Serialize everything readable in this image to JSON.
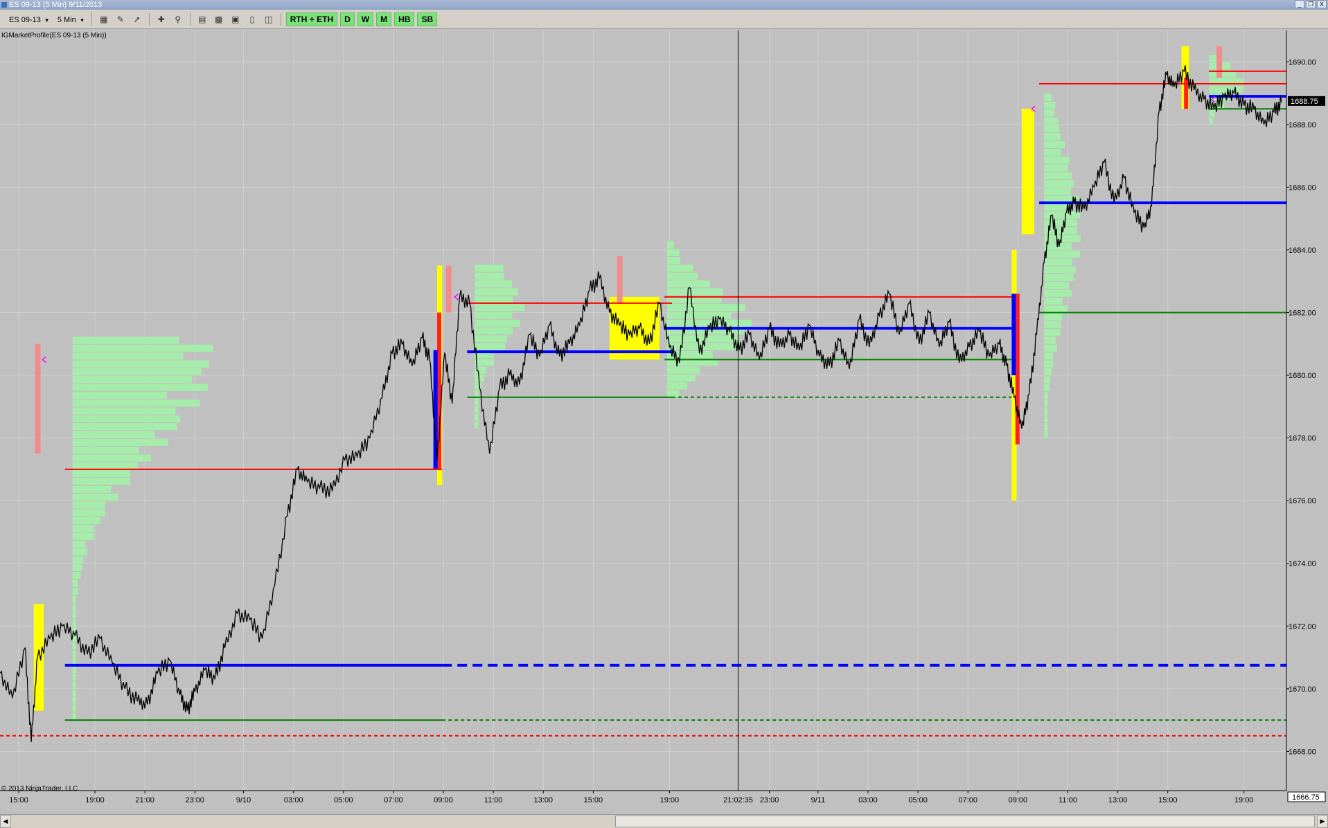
{
  "window": {
    "title": "ES 09-13 (5 Min)  9/11/2013",
    "buttons": [
      "_",
      "❐",
      "X"
    ]
  },
  "toolbar": {
    "instrument": "ES 09-13",
    "interval": "5 Min",
    "range_buttons": [
      "RTH + ETH",
      "D",
      "W",
      "M",
      "HB",
      "SB"
    ],
    "icons": [
      "bar-style-icon",
      "pencil-icon",
      "drawing-tool-icon",
      "crosshair-icon",
      "zoom-icon",
      "properties-icon",
      "strategy-icon",
      "data-box-icon",
      "indicator-icon",
      "chart-trader-icon"
    ]
  },
  "indicator_label": "IGMarketProfile(ES 09-13 (5 Min))",
  "copyright": "© 2013 NinjaTrader, LLC",
  "colors": {
    "background": "#c0c0c0",
    "grid": "#d0d0d0",
    "price": "#000000",
    "poc": "#0000ff",
    "vah": "#ff0000",
    "val": "#008000",
    "profile_green": "#a6ecaa",
    "value_area_yellow": "#ffff00",
    "tpo_pink": "#f08c8c",
    "marker_magenta": "#ff00ff"
  },
  "chart_data": {
    "type": "line",
    "title": "",
    "instrument": "ES 09-13",
    "interval": "5 Min",
    "ylim": [
      1666.75,
      1691
    ],
    "y_ticks": [
      1668,
      1670,
      1672,
      1674,
      1676,
      1678,
      1680,
      1682,
      1684,
      1686,
      1688,
      1690
    ],
    "y_tick_labels": [
      "1668.00",
      "1670.00",
      "1672.00",
      "1674.00",
      "1676.00",
      "1678.00",
      "1680.00",
      "1682.00",
      "1684.00",
      "1686.00",
      "1688.00",
      "1690.00"
    ],
    "x_tick_labels": [
      "15:00",
      "19:00",
      "21:00",
      "23:00",
      "9/10",
      "03:00",
      "05:00",
      "07:00",
      "09:00",
      "11:00",
      "13:00",
      "15:00",
      "19:00",
      "23:00",
      "9/11",
      "03:00",
      "05:00",
      "07:00",
      "09:00",
      "11:00",
      "13:00",
      "15:00",
      "19:00"
    ],
    "x_tick_positions": [
      0.75,
      3.8,
      5.8,
      7.8,
      9.75,
      11.75,
      13.75,
      15.75,
      17.75,
      19.75,
      21.75,
      23.75,
      26.8,
      30.8,
      32.75,
      34.75,
      36.75,
      38.75,
      40.75,
      42.75,
      44.75,
      46.75,
      49.8
    ],
    "x_range": [
      0,
      51.5
    ],
    "last_price": "1688.75",
    "axis_bottom_label": "1666.75",
    "crosshair": {
      "x": 29.55,
      "label": "21:02:35"
    },
    "price_series": {
      "name": "ES 09-13",
      "x": [
        0,
        0.5,
        1,
        1.25,
        1.5,
        2.0,
        2.5,
        3.0,
        3.5,
        4.0,
        4.5,
        5.0,
        5.5,
        5.9,
        6.3,
        6.8,
        7.2,
        7.5,
        7.8,
        8.2,
        8.6,
        9.0,
        9.5,
        10.0,
        10.5,
        11.0,
        11.5,
        11.9,
        12.3,
        12.8,
        13.3,
        13.8,
        14.3,
        14.8,
        15.3,
        15.7,
        16.1,
        16.5,
        16.9,
        17.2,
        17.5,
        17.8,
        18.1,
        18.4,
        18.8,
        19.2,
        19.6,
        20.0,
        20.4,
        20.8,
        21.2,
        21.6,
        22.0,
        22.4,
        22.8,
        23.2,
        23.6,
        24.0,
        24.4,
        24.8,
        25.2,
        25.6,
        26.0,
        26.4,
        26.8,
        27.2,
        27.6,
        28.0,
        28.4,
        28.8,
        29.2,
        29.6,
        30.0,
        30.4,
        30.8,
        31.2,
        31.6,
        32.0,
        32.4,
        32.8,
        33.2,
        33.6,
        34.0,
        34.4,
        34.8,
        35.2,
        35.6,
        36.0,
        36.4,
        36.8,
        37.2,
        37.6,
        38.0,
        38.4,
        38.8,
        39.2,
        39.6,
        40.0,
        40.3,
        40.6,
        40.9,
        41.2,
        41.5,
        41.8,
        42.1,
        42.4,
        42.7,
        43.0,
        43.4,
        43.8,
        44.2,
        44.6,
        45.0,
        45.4,
        45.8,
        46.1,
        46.4,
        46.7,
        47.0,
        47.4,
        47.8,
        48.2,
        48.6,
        49.0,
        49.4,
        49.8,
        50.2,
        50.6,
        51.0,
        51.3
      ],
      "y": [
        1670.5,
        1669.7,
        1671.3,
        1668.3,
        1671.0,
        1671.6,
        1672.0,
        1671.7,
        1671.1,
        1671.6,
        1670.8,
        1670.0,
        1669.6,
        1669.5,
        1670.5,
        1670.9,
        1669.8,
        1669.3,
        1669.9,
        1670.6,
        1670.3,
        1671.3,
        1672.4,
        1672.2,
        1671.6,
        1673.3,
        1675.5,
        1677.0,
        1676.6,
        1676.4,
        1676.3,
        1677.3,
        1677.4,
        1678.0,
        1679.3,
        1680.7,
        1681.0,
        1680.3,
        1681.2,
        1680.5,
        1677.3,
        1680.7,
        1679.1,
        1682.5,
        1682.3,
        1679.6,
        1677.5,
        1679.6,
        1680.0,
        1679.7,
        1681.3,
        1680.6,
        1681.6,
        1680.6,
        1681.0,
        1681.6,
        1682.7,
        1683.1,
        1682.0,
        1681.6,
        1681.3,
        1681.5,
        1681.0,
        1682.3,
        1680.9,
        1680.4,
        1682.8,
        1680.7,
        1681.5,
        1681.8,
        1681.4,
        1680.8,
        1681.3,
        1680.5,
        1681.5,
        1680.9,
        1681.3,
        1680.8,
        1681.6,
        1680.6,
        1680.3,
        1681.1,
        1680.2,
        1681.8,
        1680.9,
        1681.9,
        1682.6,
        1681.3,
        1682.3,
        1681.0,
        1682.0,
        1680.9,
        1681.7,
        1680.4,
        1680.9,
        1681.4,
        1680.6,
        1681.0,
        1680.3,
        1679.3,
        1678.3,
        1679.4,
        1681.3,
        1683.6,
        1685.1,
        1684.1,
        1685.2,
        1685.5,
        1685.3,
        1686.0,
        1686.8,
        1685.5,
        1686.3,
        1685.2,
        1684.7,
        1685.4,
        1688.4,
        1689.6,
        1689.2,
        1689.7,
        1689.1,
        1688.8,
        1688.5,
        1688.9,
        1689.0,
        1688.6,
        1688.5,
        1688.0,
        1688.4,
        1688.7
      ]
    },
    "profile_lines": [
      {
        "session": 1,
        "vah": 1677.0,
        "poc": 1670.75,
        "val": 1669.0,
        "x_start": 2.6,
        "x_end": 17.7
      },
      {
        "session": 2,
        "vah": 1682.3,
        "poc": 1680.75,
        "val": 1679.3,
        "x_start": 18.7,
        "x_end": 26.9
      },
      {
        "session": 3,
        "vah": 1682.5,
        "poc": 1681.5,
        "val": 1680.5,
        "x_start": 26.6,
        "x_end": 40.5
      },
      {
        "session": 4,
        "vah": 1689.3,
        "poc": 1685.5,
        "val": 1682.0,
        "x_start": 41.6,
        "x_end": 51.5
      },
      {
        "session": 5,
        "vah": 1689.7,
        "poc": 1688.9,
        "val": 1688.5,
        "x_start": 48.4,
        "x_end": 51.5
      }
    ],
    "extended_lines": [
      {
        "kind": "poc",
        "y": 1670.75,
        "x_start": 17.7,
        "x_end": 51.5
      },
      {
        "kind": "poc",
        "y": 1680.75,
        "x_start": 26.9,
        "x_end": 27.0
      },
      {
        "kind": "poc",
        "y": 1685.5,
        "x_start": 47.0,
        "x_end": 51.5
      },
      {
        "kind": "val",
        "y": 1669.0,
        "x_start": 17.7,
        "x_end": 51.5
      },
      {
        "kind": "val",
        "y": 1679.3,
        "x_start": 26.9,
        "x_end": 40.5
      },
      {
        "kind": "val",
        "y": 1682.0,
        "x_start": 47.0,
        "x_end": 51.5
      },
      {
        "kind": "vah",
        "y": 1668.5,
        "x_start": 0,
        "x_end": 51.5
      }
    ],
    "volume_profiles": [
      {
        "x_start": 2.9,
        "y_low": 1669.0,
        "y_high": 1681.0,
        "peak_y": 1680.3,
        "peak_width": 5.7
      },
      {
        "x_start": 19.0,
        "y_low": 1678.3,
        "y_high": 1683.5,
        "peak_y": 1682.0,
        "peak_width": 2.0
      },
      {
        "x_start": 26.7,
        "y_low": 1679.3,
        "y_high": 1684.2,
        "peak_y": 1681.5,
        "peak_width": 3.5
      },
      {
        "x_start": 41.8,
        "y_low": 1678.0,
        "y_high": 1688.8,
        "peak_y": 1684.5,
        "peak_width": 1.5
      },
      {
        "x_start": 48.4,
        "y_low": 1688.0,
        "y_high": 1690.2,
        "peak_y": 1689.2,
        "peak_width": 1.5
      }
    ],
    "value_area_bars": [
      {
        "x": 1.35,
        "y_low": 1669.3,
        "y_high": 1672.7,
        "width": 0.4
      },
      {
        "x": 17.5,
        "y_low": 1676.5,
        "y_high": 1683.5,
        "width": 0.2
      },
      {
        "x": 24.4,
        "y_low": 1680.5,
        "y_high": 1682.5,
        "width": 2.0
      },
      {
        "x": 40.5,
        "y_low": 1676.0,
        "y_high": 1684.0,
        "width": 0.2
      },
      {
        "x": 40.9,
        "y_low": 1684.5,
        "y_high": 1688.5,
        "width": 0.5
      },
      {
        "x": 47.3,
        "y_low": 1688.5,
        "y_high": 1690.5,
        "width": 0.3
      }
    ],
    "range_bars": [
      {
        "x": 17.5,
        "y_low": 1677.0,
        "y_high": 1682.0,
        "color": "red"
      },
      {
        "x": 17.35,
        "y_low": 1677.0,
        "y_high": 1680.8,
        "color": "blue"
      },
      {
        "x": 40.65,
        "y_low": 1677.8,
        "y_high": 1682.6,
        "color": "red"
      },
      {
        "x": 40.5,
        "y_low": 1680.0,
        "y_high": 1682.6,
        "color": "blue"
      },
      {
        "x": 47.4,
        "y_low": 1688.5,
        "y_high": 1689.5,
        "color": "red"
      }
    ],
    "tpo_columns": [
      {
        "x": 1.4,
        "y_low": 1677.5,
        "y_high": 1681.0
      },
      {
        "x": 17.85,
        "y_low": 1682.0,
        "y_high": 1683.5
      },
      {
        "x": 24.7,
        "y_low": 1682.3,
        "y_high": 1683.8
      },
      {
        "x": 48.7,
        "y_low": 1689.5,
        "y_high": 1690.5
      }
    ],
    "markers": [
      {
        "x": 1.7,
        "y": 1680.5
      },
      {
        "x": 18.2,
        "y": 1682.5
      },
      {
        "x": 41.3,
        "y": 1688.5
      },
      {
        "x": 48.5,
        "y": 1688.8
      }
    ]
  }
}
